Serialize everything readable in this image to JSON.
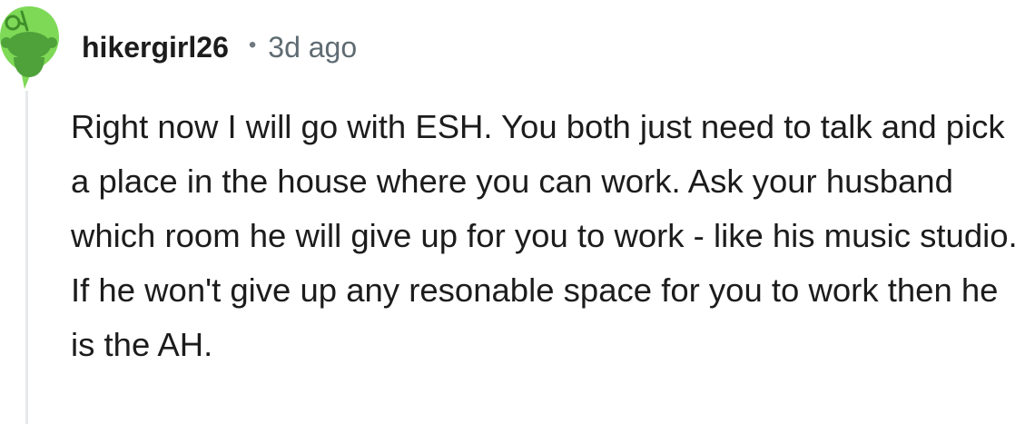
{
  "comment": {
    "username": "hikergirl26",
    "separator": "•",
    "timestamp": "3d ago",
    "avatar_icon": "snoo-avatar-icon",
    "avatar_color": "#7ed957",
    "body": "Right now I will go with ESH. You both just need to talk and pick a place in the house where you can work. Ask your husband which room he will give up for you to work - like his music studio. If he won't give up any resonable space for you to work then he is the AH."
  }
}
